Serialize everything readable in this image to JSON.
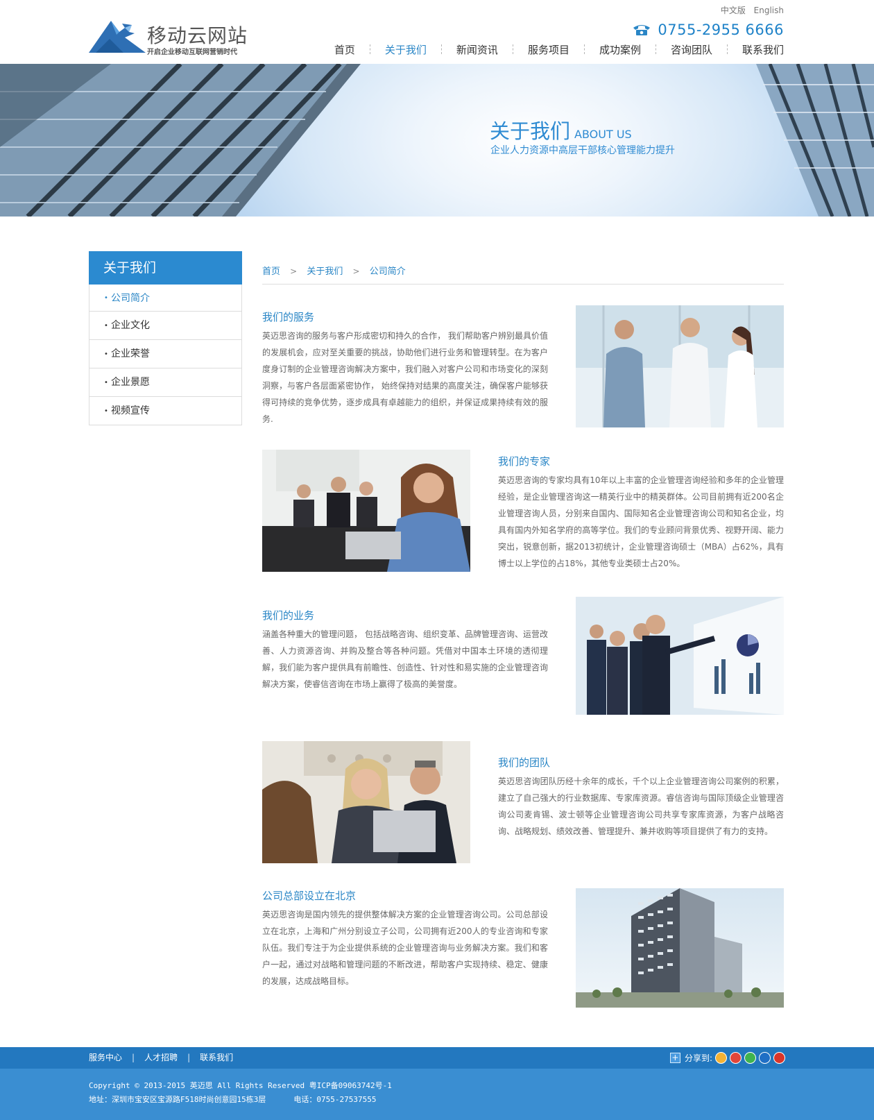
{
  "header": {
    "logo_name": "移动云网站",
    "logo_slogan": "开启企业移动互联网营销时代",
    "lang": [
      "中文版",
      "English"
    ],
    "phone": "0755-2955 6666",
    "nav": [
      "首页",
      "关于我们",
      "新闻资讯",
      "服务项目",
      "成功案例",
      "咨询团队",
      "联系我们"
    ],
    "nav_active": "关于我们"
  },
  "banner": {
    "title_cn": "关于我们",
    "title_en": "ABOUT US",
    "subtitle": "企业人力资源中高层干部核心管理能力提升"
  },
  "sidebar": {
    "title": "关于我们",
    "items": [
      "公司简介",
      "企业文化",
      "企业荣誉",
      "企业景愿",
      "视频宣传"
    ],
    "active": "公司简介"
  },
  "breadcrumb": [
    "首页",
    "关于我们",
    "公司简介"
  ],
  "sections": [
    {
      "title": "我们的服务",
      "text": "英迈思咨询的服务与客户形成密切和持久的合作， 我们帮助客户辨别最具价值的发展机会，应对至关重要的挑战，协助他们进行业务和管理转型。在为客户度身订制的企业管理咨询解决方案中，我们融入对客户公司和市场变化的深刻洞察，与客户各层面紧密协作， 始终保持对结果的高度关注，确保客户能够获得可持续的竞争优势，逐步成具有卓越能力的组织，并保证成果持续有效的服务."
    },
    {
      "title": "我们的专家",
      "text": "英迈思咨询的专家均具有10年以上丰富的企业管理咨询经验和多年的企业管理经验，是企业管理咨询这一精英行业中的精英群体。公司目前拥有近200名企业管理咨询人员，分别来自国内、国际知名企业管理咨询公司和知名企业，均具有国内外知名学府的高等学位。我们的专业顾问背景优秀、视野开阔、能力突出，锐意创新，据2013初统计，企业管理咨询硕士（MBA）占62%，具有博士以上学位的占18%，其他专业类硕士占20%。"
    },
    {
      "title": "我们的业务",
      "text": "涵盖各种重大的管理问题， 包括战略咨询、组织变革、品牌管理咨询、运营改善、人力资源咨询、并购及整合等各种问题。凭借对中国本土环境的透彻理解，我们能为客户提供具有前瞻性、创造性、针对性和易实施的企业管理咨询解决方案，使睿信咨询在市场上赢得了极高的美誉度。"
    },
    {
      "title": "我们的团队",
      "text": "英迈思咨询团队历经十余年的成长，千个以上企业管理咨询公司案例的积累，建立了自己强大的行业数据库、专家库资源。睿信咨询与国际顶级企业管理咨询公司麦肯锡、波士顿等企业管理咨询公司共享专家库资源，为客户战略咨询、战略规划、绩效改善、管理提升、兼并收购等项目提供了有力的支持。"
    },
    {
      "title": "公司总部设立在北京",
      "text": "英迈思咨询是国内领先的提供整体解决方案的企业管理咨询公司。公司总部设立在北京，上海和广州分别设立子公司，公司拥有近200人的专业咨询和专家队伍。我们专注于为企业提供系统的企业管理咨询与业务解决方案。我们和客户一起，通过对战略和管理问题的不断改进，帮助客户实现持续、稳定、健康的发展，达成战略目标。"
    }
  ],
  "footer": {
    "links": [
      "服务中心",
      "人才招聘",
      "联系我们"
    ],
    "share_label": "分享到:",
    "share_icons": [
      "qzone-icon",
      "weibo-icon",
      "wechat-icon",
      "renren-icon",
      "tencent-weibo-icon"
    ],
    "copyright": "Copyright © 2013-2015 英迈思 All Rights Reserved 粤ICP备09063742号-1",
    "address": "地址：深圳市宝安区宝源路F518时尚创意园15栋3层",
    "tel": "电话：0755-27537555"
  },
  "colors": {
    "accent": "#2a86c6",
    "sidebar_head": "#2b8ad0",
    "footer_top": "#2378bf",
    "footer_bottom": "#3a8ed2"
  }
}
